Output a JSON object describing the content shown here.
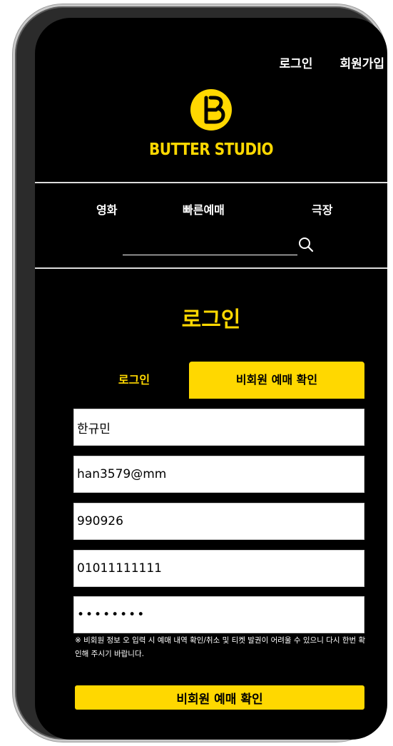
{
  "header": {
    "login_link": "로그인",
    "signup_link": "회원가입"
  },
  "brand": {
    "name": "BUTTER STUDIO",
    "color": "#ffd800"
  },
  "nav": {
    "items": [
      "영화",
      "빠른예매",
      "극장"
    ]
  },
  "search": {
    "value": "",
    "icon": "search-icon"
  },
  "page": {
    "title": "로그인"
  },
  "tabs": {
    "login": "로그인",
    "guest": "비회원 예매 확인",
    "active": "guest"
  },
  "form": {
    "name": "한규민",
    "email": "han3579@mm",
    "birth": "990926",
    "phone": "01011111111",
    "password": "••••••••"
  },
  "notice": "※ 비회원 정보 오 입력 시 예매 내역 확인/취소 및 티켓 발권이 어려울 수 있으니 다시 한번 확인해 주시기 바랍니다.",
  "submit_label": "비회원 예매 확인"
}
